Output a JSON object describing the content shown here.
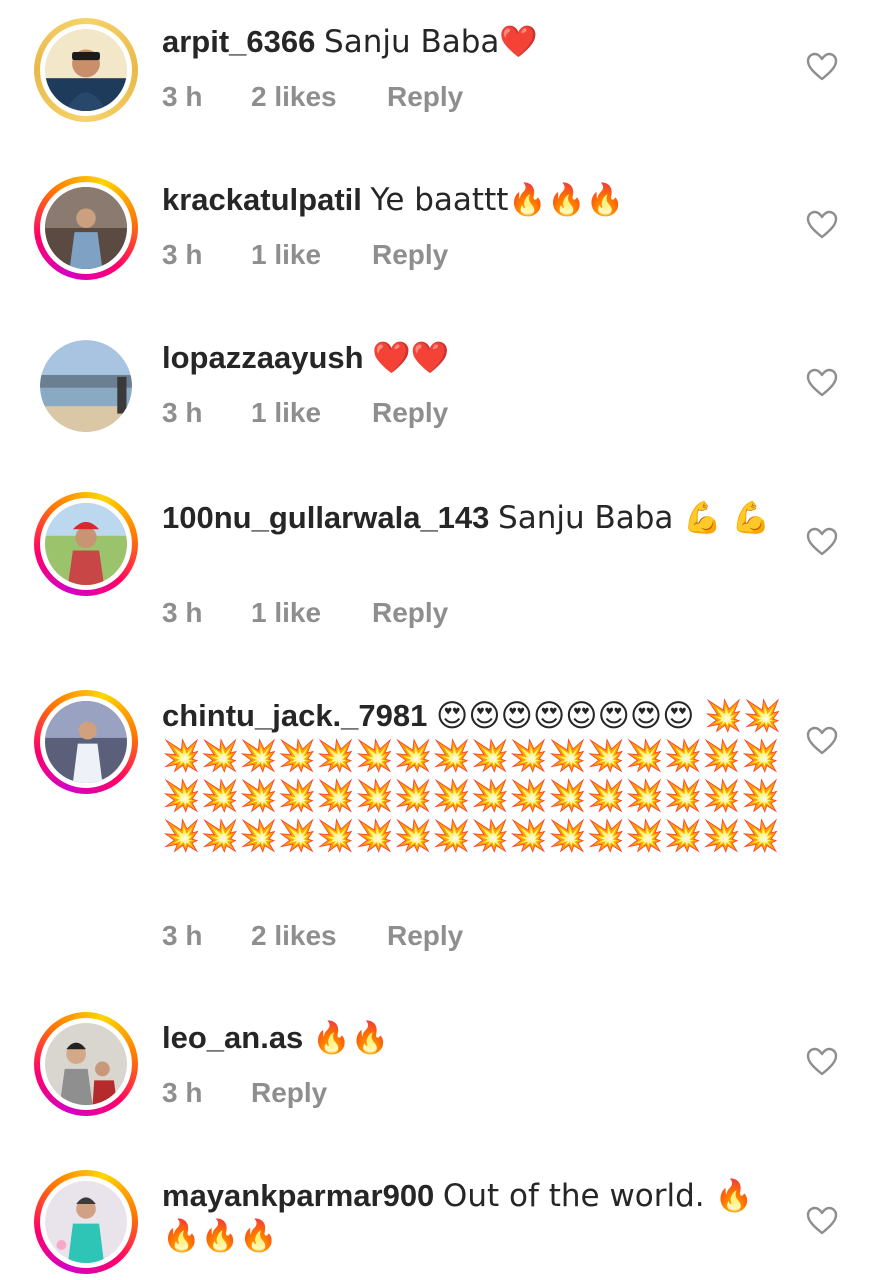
{
  "comments": [
    {
      "username": "arpit_6366",
      "text": "Sanju Baba❤️",
      "time": "3 h",
      "likes": "2 likes",
      "reply": "Reply"
    },
    {
      "username": "krackatulpatil",
      "text": "Ye baattt🔥🔥🔥",
      "time": "3 h",
      "likes": "1 like",
      "reply": "Reply"
    },
    {
      "username": "lopazzaayush",
      "text": "❤️❤️",
      "time": "3 h",
      "likes": "1 like",
      "reply": "Reply"
    },
    {
      "username": "100nu_gullarwala_143",
      "text": "Sanju Baba 💪 💪",
      "time": "3 h",
      "likes": "1 like",
      "reply": "Reply"
    },
    {
      "username": "chintu_jack._7981",
      "text": "😍😍😍😍😍😍😍😍 💥💥💥💥💥💥💥💥💥💥💥💥💥💥💥💥💥💥💥💥💥💥💥💥💥💥💥💥💥💥💥💥💥💥💥💥💥💥💥💥💥💥💥💥💥💥💥💥💥💥",
      "time": "3 h",
      "likes": "2 likes",
      "reply": "Reply"
    },
    {
      "username": "leo_an.as",
      "text": "🔥🔥",
      "time": "3 h",
      "likes": "",
      "reply": "Reply"
    },
    {
      "username": "mayankparmar900",
      "text": "Out of the world. 🔥🔥🔥🔥",
      "time": "",
      "likes": "",
      "reply": ""
    }
  ],
  "icons": {
    "like": "heart-outline-icon"
  },
  "colors": {
    "text": "#262626",
    "meta": "#8e8e8e",
    "story_ring_start": "#d300c5",
    "story_ring_end": "#ffd600"
  }
}
